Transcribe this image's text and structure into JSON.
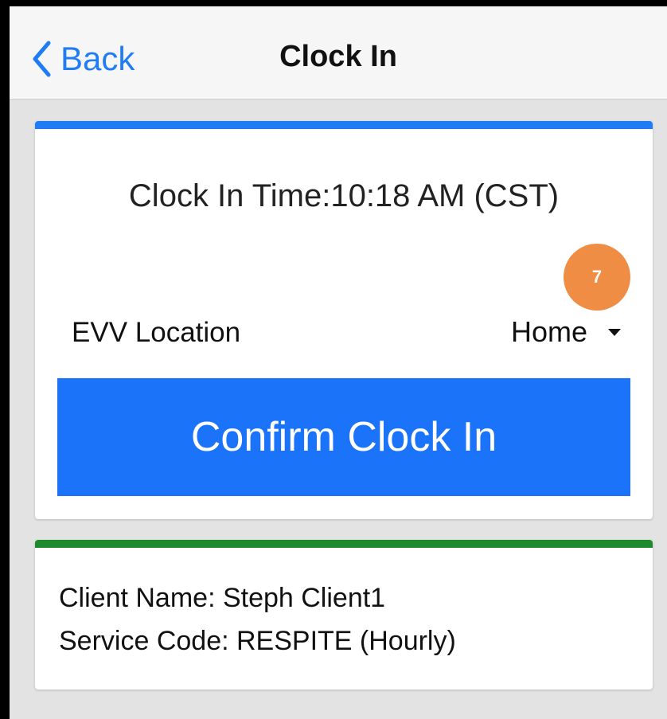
{
  "colors": {
    "accent_blue": "#1a73f8",
    "back_blue": "#1f7cf5",
    "clock_card_top": "#1f7cf5",
    "info_card_top": "#1e8a2e",
    "badge": "#ef8d44"
  },
  "navbar": {
    "back_icon": "chevron-left-icon",
    "back_label": "Back",
    "title": "Clock In"
  },
  "clock_card": {
    "clock_in_time": "Clock In Time:10:18 AM (CST)",
    "badge_count": "7",
    "evv_location_label": "EVV Location",
    "evv_location_value": "Home",
    "dropdown_icon": "caret-down-icon",
    "confirm_label": "Confirm Clock In"
  },
  "info_card": {
    "client_name": "Client Name: Steph Client1",
    "service_code": "Service Code: RESPITE (Hourly)"
  }
}
